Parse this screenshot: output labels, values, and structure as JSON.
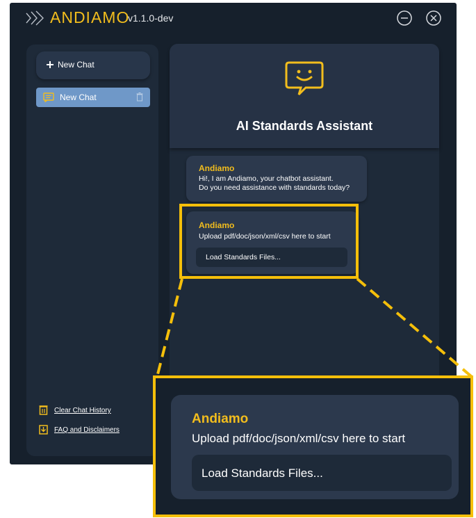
{
  "app": {
    "brand": "ANDIAMO",
    "version": "v1.1.0-dev",
    "accent_color": "#f2bd1d",
    "icons": {
      "logo": "chevrons-logo-icon",
      "minimize": "minimize-circle-icon",
      "close": "close-circle-icon"
    }
  },
  "sidebar": {
    "new_chat_label": "New Chat",
    "chats": [
      {
        "label": "New Chat",
        "icon": "chat-icon",
        "selected": true
      }
    ],
    "footer": {
      "clear_history": "Clear Chat History",
      "faq": "FAQ and Disclaimers"
    }
  },
  "main": {
    "title": "AI Standards Assistant",
    "messages": [
      {
        "sender": "Andiamo",
        "lines": [
          "Hi!, I am Andiamo, your chatbot assistant.",
          "Do you need assistance with standards today?"
        ]
      },
      {
        "sender": "Andiamo",
        "lines": [
          "Upload pdf/doc/json/xml/csv here to start"
        ],
        "button": "Load Standards Files..."
      }
    ]
  },
  "zoom": {
    "sender": "Andiamo",
    "line": "Upload pdf/doc/json/xml/csv here to start",
    "button": "Load Standards Files...",
    "highlight_color": "#f5bf0a"
  }
}
